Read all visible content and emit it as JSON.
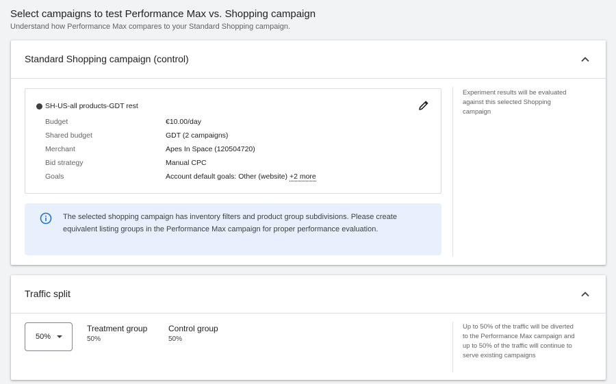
{
  "page": {
    "title": "Select campaigns to test Performance Max vs. Shopping campaign",
    "subtitle": "Understand how Performance Max compares to your Standard Shopping campaign."
  },
  "control_card": {
    "title": "Standard Shopping campaign (control)",
    "side_note": "Experiment results will be evaluated against this selected Shopping campaign",
    "campaign_name": "SH-US-all products-GDT rest",
    "rows": [
      {
        "label": "Budget",
        "value": "€10.00/day"
      },
      {
        "label": "Shared budget",
        "value": "GDT (2 campaigns)"
      },
      {
        "label": "Merchant",
        "value": "Apes In Space (120504720)"
      },
      {
        "label": "Bid strategy",
        "value": "Manual CPC"
      },
      {
        "label": "Goals",
        "value": "Account default goals: Other (website)",
        "more": "+2 more"
      }
    ],
    "info_text": "The selected shopping campaign has inventory filters and product group subdivisions. Please create equivalent listing groups in the Performance Max campaign for proper performance evaluation."
  },
  "traffic_card": {
    "title": "Traffic split",
    "split_select_value": "50%",
    "treatment_label": "Treatment group",
    "treatment_value": "50%",
    "control_label": "Control group",
    "control_value": "50%",
    "side_note": "Up to 50% of the traffic will be diverted to the Performance Max campaign and up to 50% of the traffic will continue to serve existing campaigns"
  },
  "colors": {
    "background": "#f1f3f4",
    "info_background": "#e8f0fe",
    "info_icon": "#1a73e8"
  },
  "icons": {
    "collapse": "chevron-up-icon",
    "edit": "pencil-icon",
    "info": "info-icon",
    "dropdown": "caret-down-icon"
  }
}
